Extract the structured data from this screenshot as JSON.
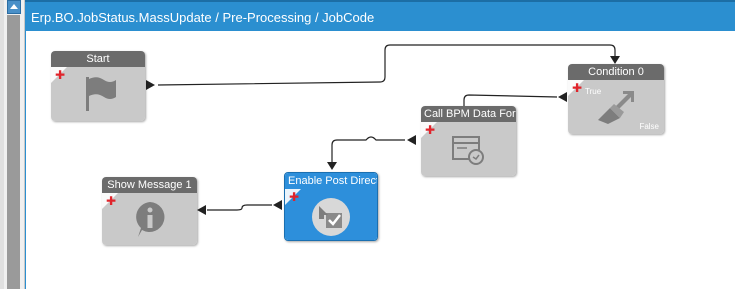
{
  "header": {
    "title": "Erp.BO.JobStatus.MassUpdate / Pre-Processing / JobCode"
  },
  "colors": {
    "header_bg": "#2b8fd0",
    "node_title": "#6b6b6b",
    "node_body": "#c9c9c9",
    "selected": "#2d8fdb",
    "plus": "#e0242b"
  },
  "nodes": {
    "start": {
      "title": "Start",
      "icon": "flag-icon"
    },
    "condition": {
      "title": "Condition 0",
      "true_label": "True",
      "false_label": "False",
      "icon": "condition-arrows-icon"
    },
    "call_bpm": {
      "title": "Call BPM Data Forr",
      "icon": "bpm-form-icon"
    },
    "enable_post": {
      "title": "Enable Post Directi",
      "icon": "post-processing-icon",
      "selected": true
    },
    "show_message": {
      "title": "Show Message 1",
      "icon": "info-icon"
    }
  }
}
